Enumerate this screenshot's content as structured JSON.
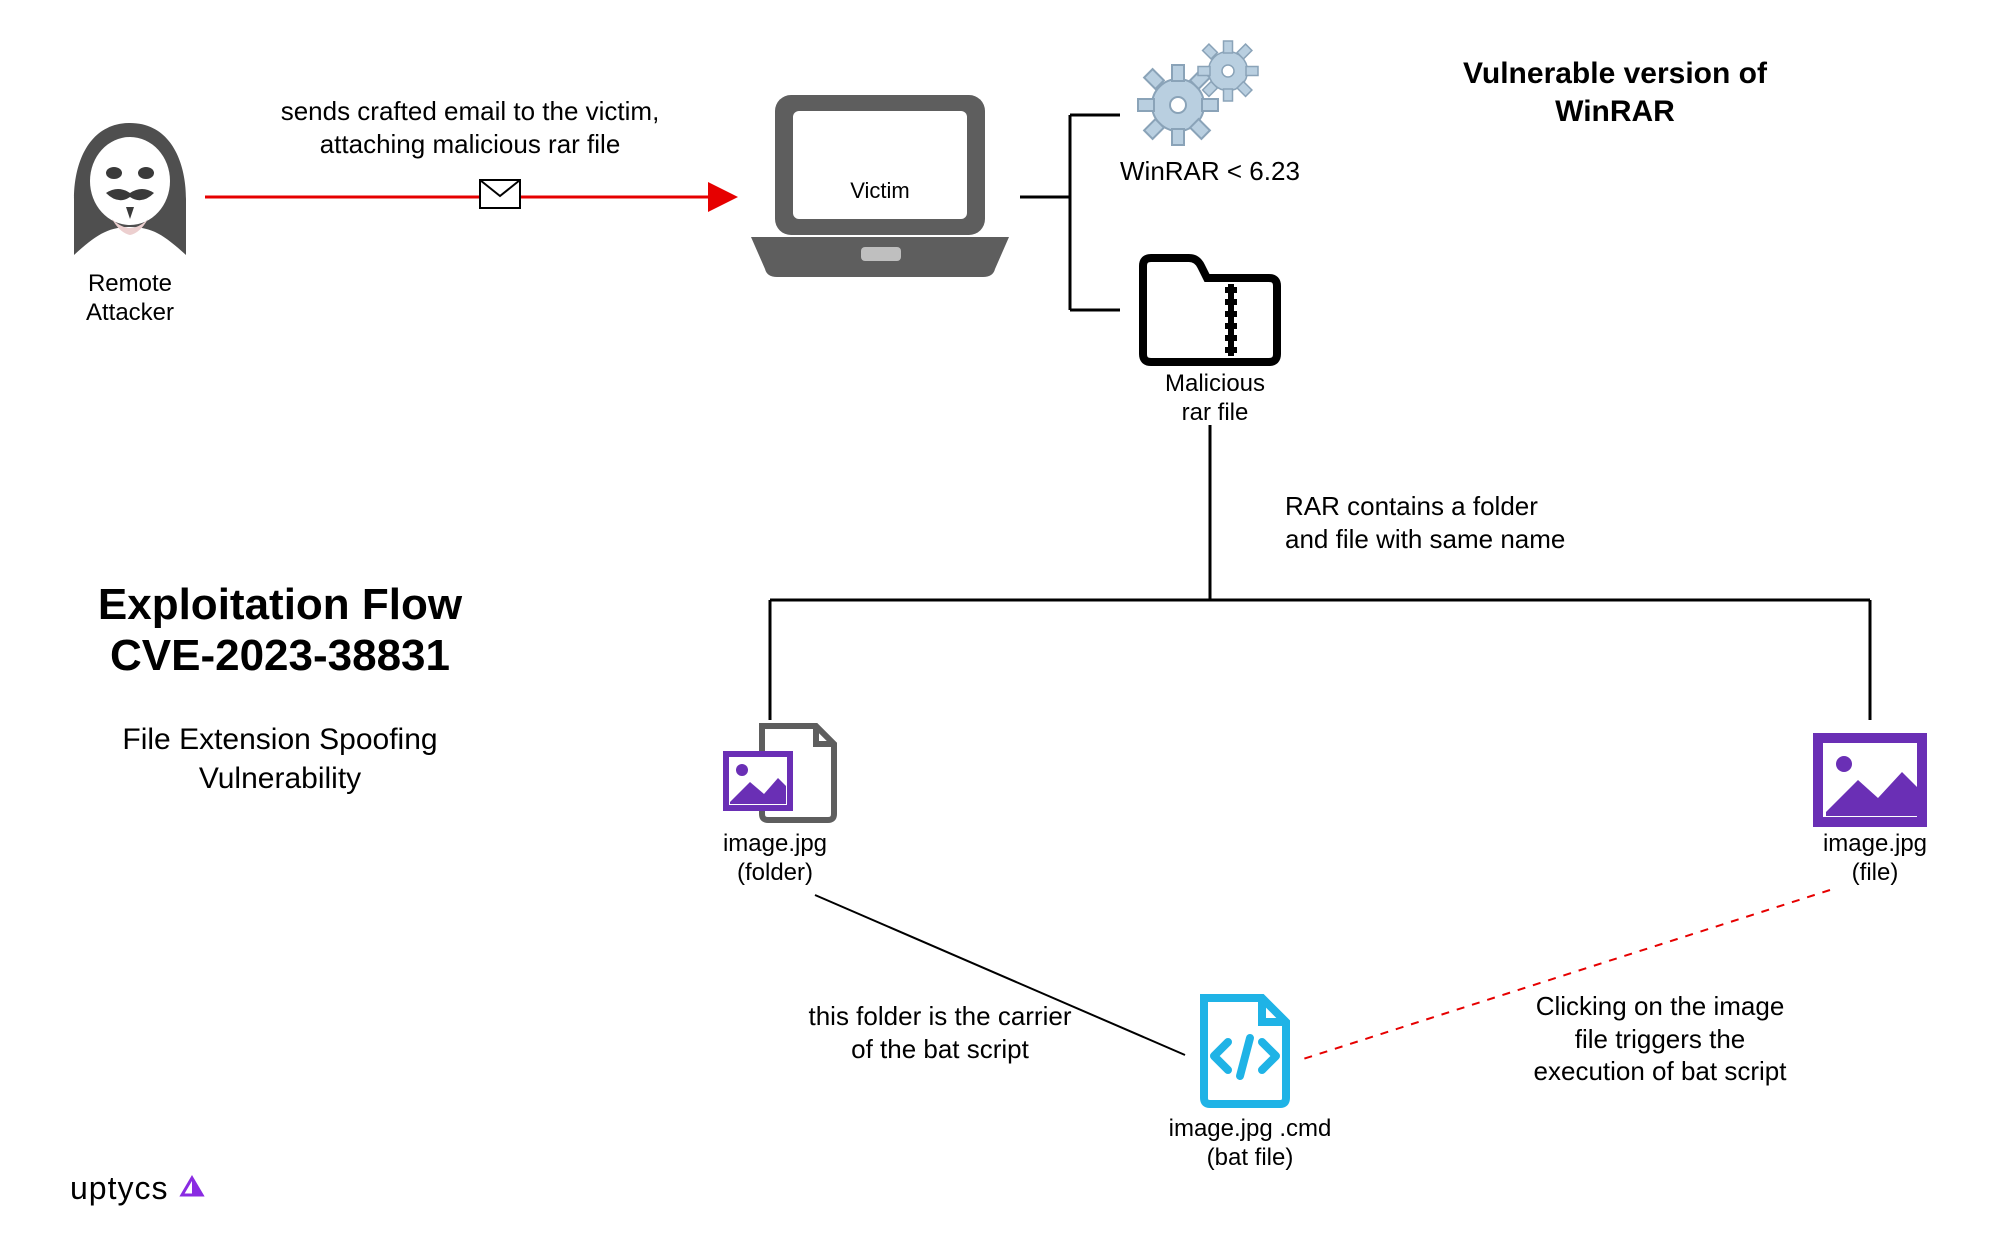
{
  "title": "Exploitation Flow\nCVE-2023-38831",
  "subtitle": "File Extension Spoofing\nVulnerability",
  "vuln_heading": "Vulnerable version of\nWinRAR",
  "nodes": {
    "attacker": "Remote\nAttacker",
    "email_note": "sends crafted email to the victim,\nattaching malicious rar file",
    "victim": "Victim",
    "winrar_label": "WinRAR < 6.23",
    "rar_file": "Malicious\nrar file",
    "rar_contains": "RAR contains a folder\nand file with same name",
    "folder_item": "image.jpg\n(folder)",
    "file_item": "image.jpg\n(file)",
    "cmd_file": "image.jpg .cmd\n(bat file)",
    "carrier_note": "this folder is the carrier\nof the bat script",
    "click_note": "Clicking on the image\nfile triggers the\nexecution of bat script"
  },
  "brand": "uptycs"
}
